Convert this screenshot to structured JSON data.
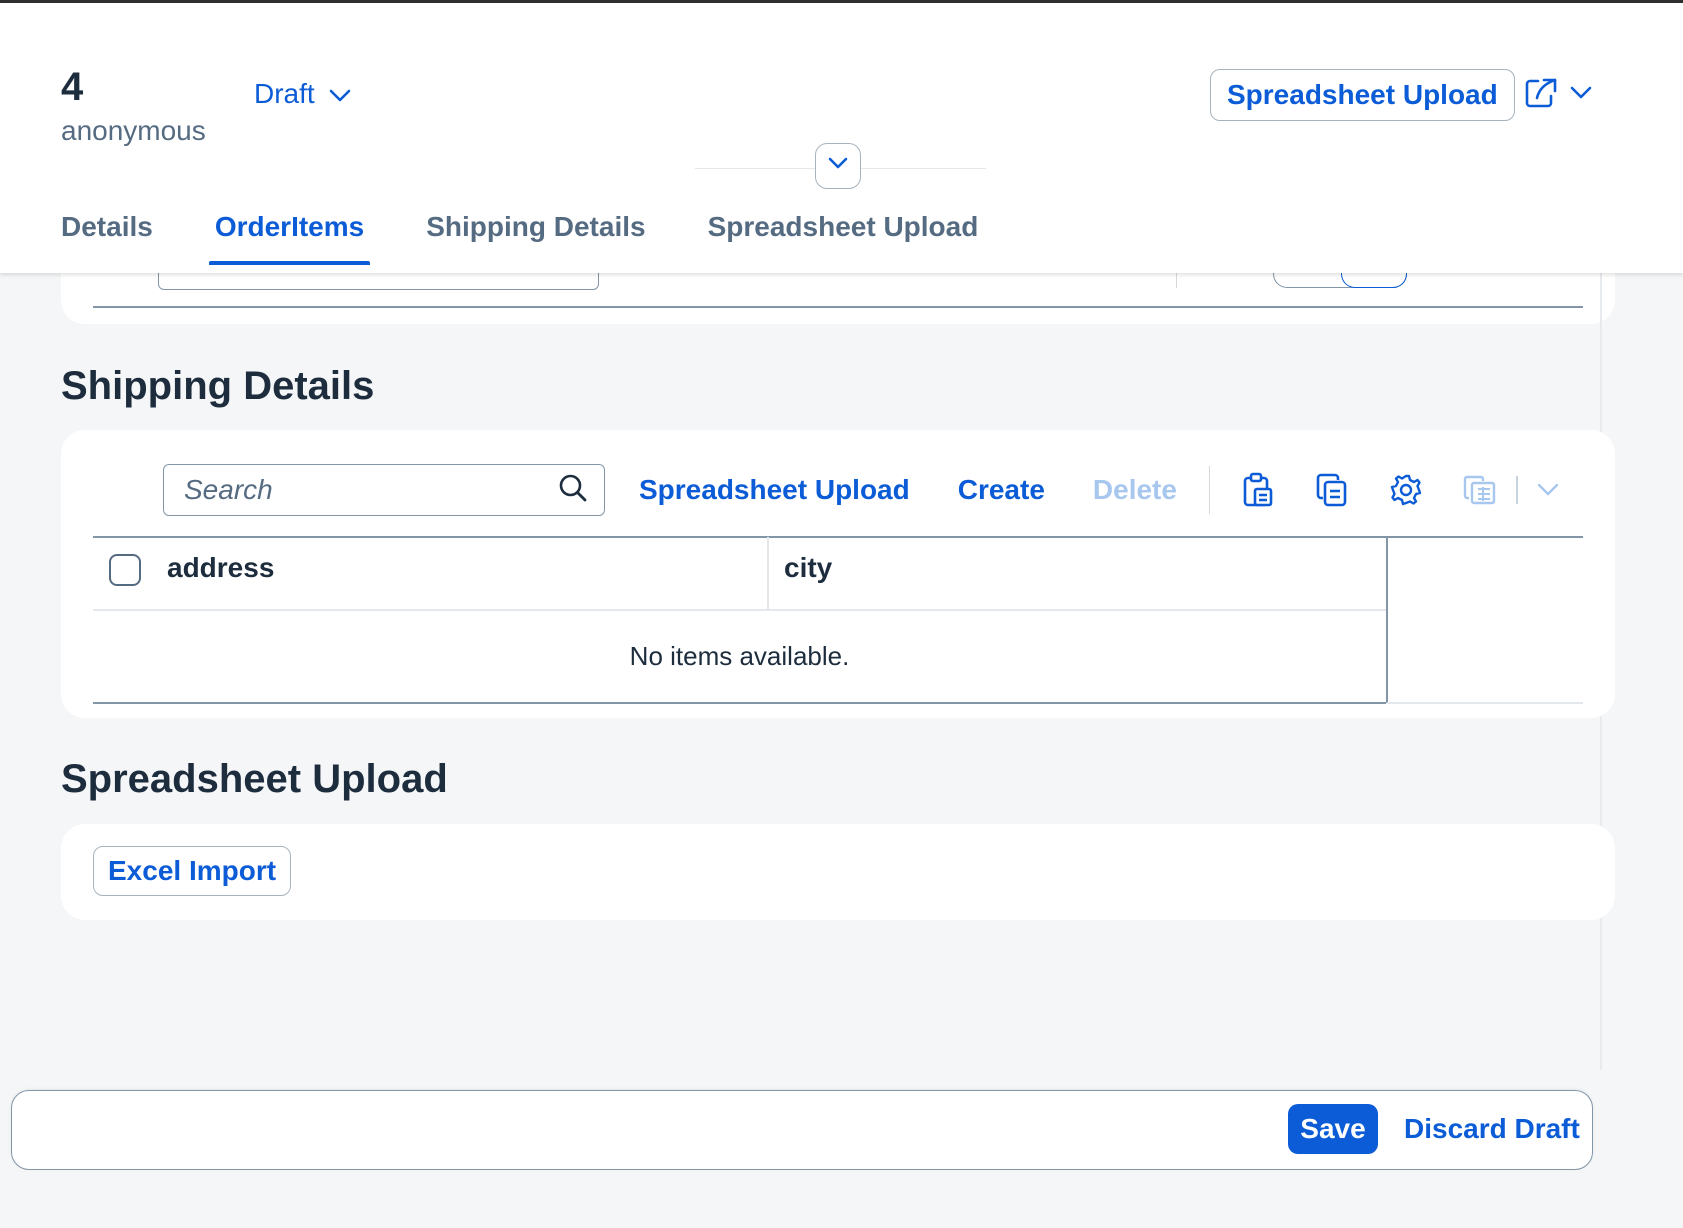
{
  "header": {
    "title": "4",
    "subtitle": "anonymous",
    "draft_status": "Draft",
    "spreadsheet_upload_label": "Spreadsheet Upload"
  },
  "tabs": [
    {
      "label": "Details",
      "active": false
    },
    {
      "label": "OrderItems",
      "active": true
    },
    {
      "label": "Shipping Details",
      "active": false
    },
    {
      "label": "Spreadsheet Upload",
      "active": false
    }
  ],
  "shipping_section": {
    "title": "Shipping Details",
    "toolbar": {
      "search_placeholder": "Search",
      "spreadsheet_upload_label": "Spreadsheet Upload",
      "create_label": "Create",
      "delete_label": "Delete"
    },
    "table": {
      "columns": [
        "address",
        "city"
      ],
      "empty_text": "No items available."
    }
  },
  "upload_section": {
    "title": "Spreadsheet Upload",
    "excel_import_label": "Excel Import"
  },
  "footer": {
    "save_label": "Save",
    "discard_label": "Discard Draft"
  },
  "colors": {
    "accent": "#0b5cd6",
    "disabled": "#a8c7ef",
    "text": "#1d2d3e",
    "muted": "#556b82",
    "background": "#f5f6f7"
  }
}
